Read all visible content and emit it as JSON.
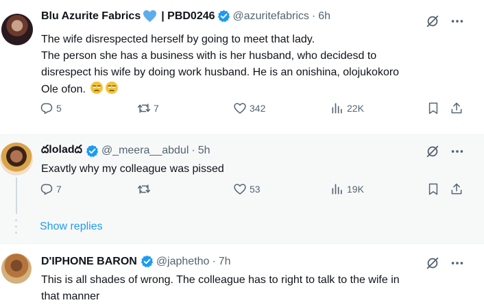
{
  "tweets": [
    {
      "name": "Blu Azurite Fabrics",
      "name_suffix": "| PBD0246",
      "handle": "@azuritefabrics",
      "time": "6h",
      "lines": [
        "The wife disrespected herself by going to meet that lady.",
        "The person she has a business with is her husband, who decidesd to",
        "disrespect his wife by doing work husband. He is an onishina, olojukokoro",
        "Ole ofon."
      ],
      "emojis": [
        "unamused-face-icon",
        "unamused-face-icon"
      ],
      "replies": "5",
      "retweets": "7",
      "likes": "342",
      "views": "22K"
    },
    {
      "name": "దloladద",
      "handle": "@_meera__abdul",
      "time": "5h",
      "lines": [
        "Exavtly why my colleague was pissed"
      ],
      "replies": "7",
      "retweets": "",
      "likes": "53",
      "views": "19K"
    },
    {
      "name": "D'IPHONE BARON",
      "handle": "@japhetho",
      "time": "7h",
      "lines": [
        "This is all shades of wrong. The colleague has to right to talk to the wife in",
        "that manner"
      ]
    }
  ],
  "show_replies_label": "Show replies",
  "separator": "·",
  "colors": {
    "text": "#0f1419",
    "secondary": "#536471",
    "accent": "#1d9bf0",
    "verified": "#1d9bf0",
    "highlight_bg": "#f7f9f9"
  },
  "icons": [
    "reply-icon",
    "retweet-icon",
    "like-icon",
    "views-icon",
    "bookmark-icon",
    "share-icon",
    "grok-icon",
    "more-icon",
    "verified-icon",
    "blue-heart-icon"
  ]
}
